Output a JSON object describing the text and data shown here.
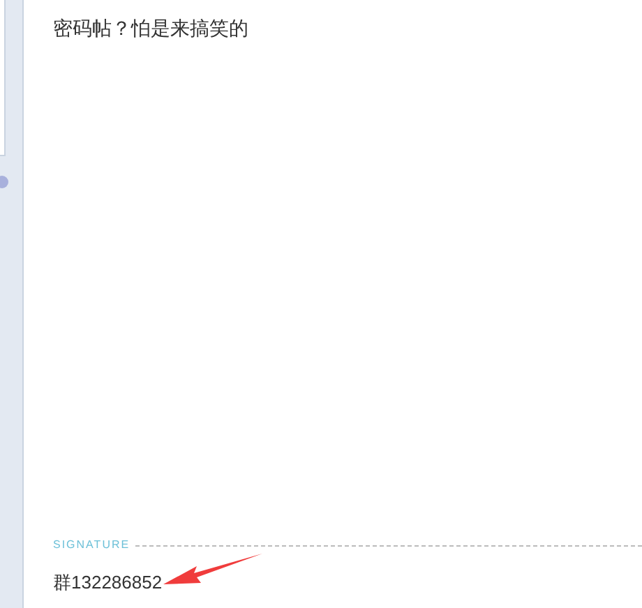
{
  "post": {
    "text": "密码帖？怕是来搞笑的"
  },
  "signature": {
    "label": "SIGNATURE",
    "text": "群132286852"
  }
}
